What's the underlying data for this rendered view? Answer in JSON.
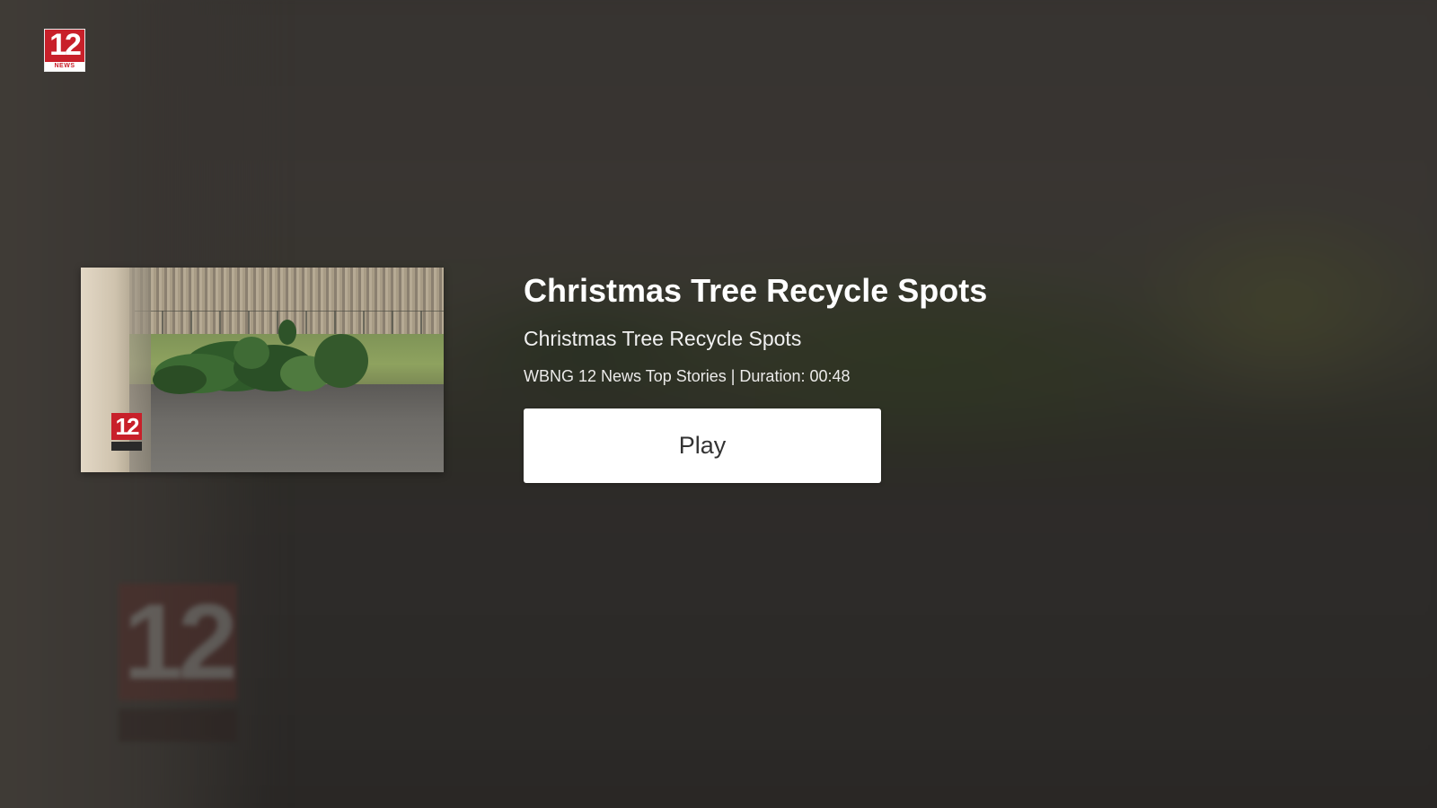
{
  "branding": {
    "logo_number": "12",
    "logo_band_text": "NEWS",
    "accent_color": "#c8202a"
  },
  "video": {
    "title": "Christmas Tree Recycle Spots",
    "description": "Christmas Tree Recycle Spots",
    "meta": "WBNG 12 News Top Stories | Duration: 00:48",
    "thumbnail_logo_number": "12"
  },
  "actions": {
    "play_label": "Play"
  },
  "background": {
    "watermark_number": "12"
  }
}
